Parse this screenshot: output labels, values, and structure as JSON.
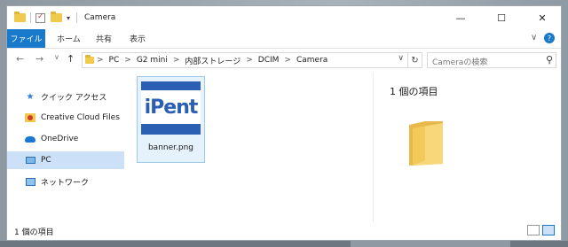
{
  "window": {
    "title": "Camera",
    "controls": {
      "minimize": "—",
      "maximize": "☐",
      "close": "✕"
    }
  },
  "ribbon": {
    "file_tab": "ファイル",
    "tabs": [
      "ホーム",
      "共有",
      "表示"
    ],
    "expand": "∨",
    "help": "?"
  },
  "address": {
    "breadcrumb": [
      "PC",
      "G2 mini",
      "内部ストレージ",
      "DCIM",
      "Camera"
    ],
    "separator": ">",
    "search_placeholder": "Cameraの検索"
  },
  "sidebar": {
    "items": [
      {
        "label": "クイック アクセス",
        "icon": "star-icon"
      },
      {
        "label": "Creative Cloud Files",
        "icon": "creative-cloud-folder-icon"
      },
      {
        "label": "OneDrive",
        "icon": "cloud-icon"
      },
      {
        "label": "PC",
        "icon": "computer-icon",
        "selected": true
      },
      {
        "label": "ネットワーク",
        "icon": "network-icon"
      }
    ]
  },
  "files": [
    {
      "name": "banner.png",
      "thumbnail_text": "iPent"
    }
  ],
  "preview": {
    "title": "1 個の項目"
  },
  "status": {
    "text": "1 個の項目"
  },
  "colors": {
    "accent": "#1979ca",
    "selection": "#cce0f7",
    "folder": "#f0c94d"
  }
}
